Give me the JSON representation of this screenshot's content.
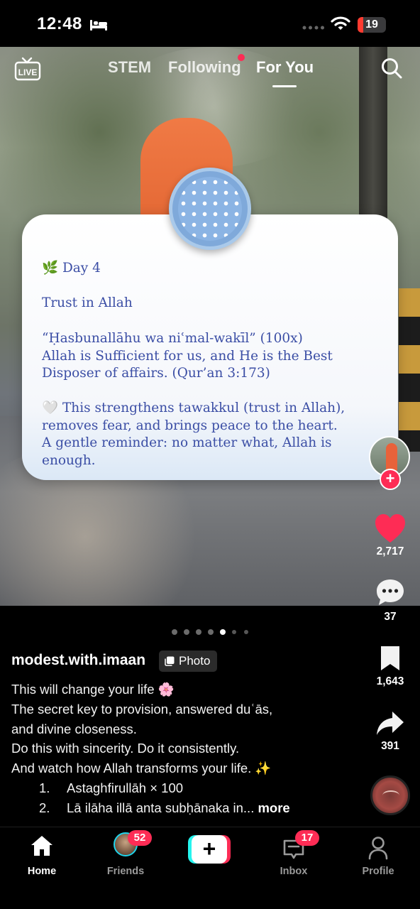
{
  "status_bar": {
    "time": "12:48",
    "battery": "19",
    "battery_level": 0.19
  },
  "top_nav": {
    "live_icon": "live-tv-icon",
    "tabs": [
      {
        "label": "STEM",
        "active": false
      },
      {
        "label": "Following",
        "active": false,
        "has_new_dot": true
      },
      {
        "label": "For You",
        "active": true
      }
    ],
    "search_icon": "search-icon"
  },
  "card": {
    "day_emoji": "🌿",
    "day": "Day 4",
    "topic": "Trust in Allah",
    "dhikr": "“Ḥasbunallāhu wa niʿmal-wakīl” (100x)",
    "translation_lines": [
      "Allah is Sufficient for us, and He is the Best",
      "Disposer of affairs. (Qur’an 3:173)"
    ],
    "benefit_emoji": "🤍",
    "benefit_lines": [
      "This strengthens tawakkul (trust in Allah),",
      "removes fear, and brings peace to the heart.",
      "A gentle reminder: no matter what, Allah is",
      "enough."
    ]
  },
  "right_rail": {
    "follow_plus": "+",
    "likes": "2,717",
    "comments": "37",
    "saves": "1,643",
    "shares": "391",
    "accent": "#fe2c55"
  },
  "pagination": {
    "total": 7,
    "active_index": 4
  },
  "post": {
    "username": "modest.with.imaan",
    "type_tag": "Photo",
    "caption_lines": [
      "This will change your life 🌸",
      "The secret key to provision, answered duʿās,",
      "and divine closeness.",
      "Do this with sincerity. Do it consistently.",
      "And watch how Allah transforms your life. ✨"
    ],
    "list": [
      {
        "num": "1.",
        "text": "Astaghfirullāh × 100"
      },
      {
        "num": "2.",
        "text": "Lā ilāha illā anta subḥānaka in..."
      }
    ],
    "more": "more"
  },
  "bottom_nav": {
    "items": [
      {
        "label": "Home",
        "icon": "home-icon",
        "active": true
      },
      {
        "label": "Friends",
        "icon": "friends-avatar",
        "badge": "52"
      },
      {
        "label": "",
        "icon": "create-plus-icon"
      },
      {
        "label": "Inbox",
        "icon": "inbox-icon",
        "badge": "17"
      },
      {
        "label": "Profile",
        "icon": "profile-icon"
      }
    ]
  }
}
